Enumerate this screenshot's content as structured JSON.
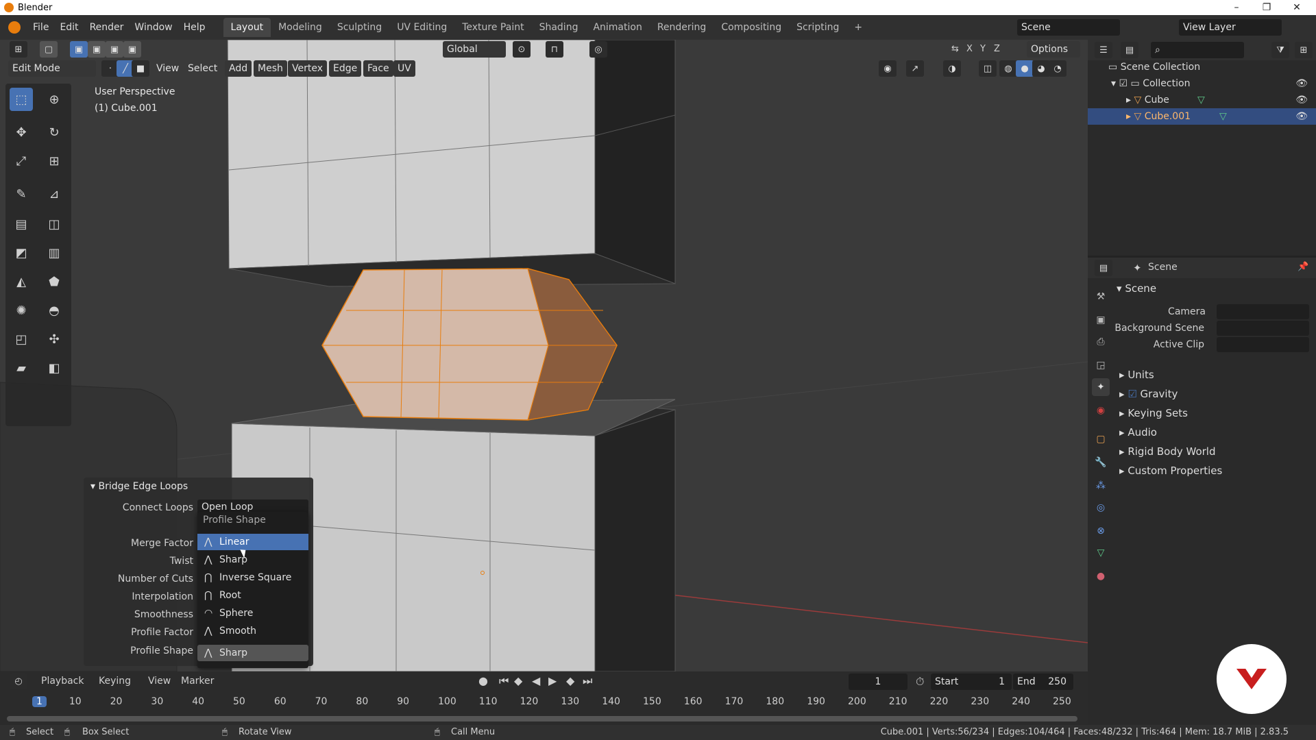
{
  "window": {
    "title": "Blender",
    "minimize": "–",
    "maximize": "❐",
    "close": "✕"
  },
  "menu": [
    "File",
    "Edit",
    "Render",
    "Window",
    "Help"
  ],
  "workspaces": [
    "Layout",
    "Modeling",
    "Sculpting",
    "UV Editing",
    "Texture Paint",
    "Shading",
    "Animation",
    "Rendering",
    "Compositing",
    "Scripting",
    "+"
  ],
  "scene_field": "Scene",
  "view_layer_field": "View Layer",
  "viewport_header": {
    "transform_orientation": "Global",
    "axes": [
      "X",
      "Y",
      "Z"
    ],
    "options": "Options",
    "mode": "Edit Mode",
    "menus": [
      "View",
      "Select",
      "Add",
      "Mesh",
      "Vertex",
      "Edge",
      "Face",
      "UV"
    ]
  },
  "viewport_overlay": {
    "perspective": "User Perspective",
    "object": "(1) Cube.001"
  },
  "operator_panel": {
    "title": "Bridge Edge Loops",
    "rows": [
      {
        "label": "Connect Loops",
        "value": "Open Loop"
      },
      {
        "label": "Merge Factor",
        "value": ""
      },
      {
        "label": "Twist",
        "value": ""
      },
      {
        "label": "Number of Cuts",
        "value": ""
      },
      {
        "label": "Interpolation",
        "value": ""
      },
      {
        "label": "Smoothness",
        "value": ""
      },
      {
        "label": "Profile Factor",
        "value": ""
      },
      {
        "label": "Profile Shape",
        "value": "Sharp"
      }
    ],
    "dropdown": {
      "header": "Profile Shape",
      "items": [
        "Linear",
        "Sharp",
        "Inverse Square",
        "Root",
        "Sphere",
        "Smooth"
      ],
      "highlighted": "Linear"
    }
  },
  "timeline": {
    "menus": [
      "Playback",
      "Keying",
      "View",
      "Marker"
    ],
    "current_frame": "1",
    "start_label": "Start",
    "start": "1",
    "end_label": "End",
    "end": "250",
    "ruler": [
      "1",
      "10",
      "20",
      "30",
      "40",
      "50",
      "60",
      "70",
      "80",
      "90",
      "100",
      "110",
      "120",
      "130",
      "140",
      "150",
      "160",
      "170",
      "180",
      "190",
      "200",
      "210",
      "220",
      "230",
      "240",
      "250"
    ]
  },
  "status_bar": {
    "select": "Select",
    "box_select": "Box Select",
    "rotate_view": "Rotate View",
    "call_menu": "Call Menu",
    "stats": "Cube.001 | Verts:56/234 | Edges:104/464 | Faces:48/232 | Tris:464 | Mem: 18.7 MiB | 2.83.5"
  },
  "outliner": {
    "root": "Scene Collection",
    "items": [
      {
        "name": "Collection",
        "level": 1
      },
      {
        "name": "Cube",
        "level": 2
      },
      {
        "name": "Cube.001",
        "level": 2,
        "selected": true
      }
    ]
  },
  "properties": {
    "header": "Scene",
    "section": "Scene",
    "fields": [
      "Camera",
      "Background Scene",
      "Active Clip"
    ],
    "subsections": [
      "Units",
      "Gravity",
      "Keying Sets",
      "Audio",
      "Rigid Body World",
      "Custom Properties"
    ]
  },
  "colors": {
    "accent": "#4772b3",
    "selection": "#e87d0d",
    "viewport_bg": "#3a3a3a",
    "panel_bg": "#2a2a2a"
  }
}
